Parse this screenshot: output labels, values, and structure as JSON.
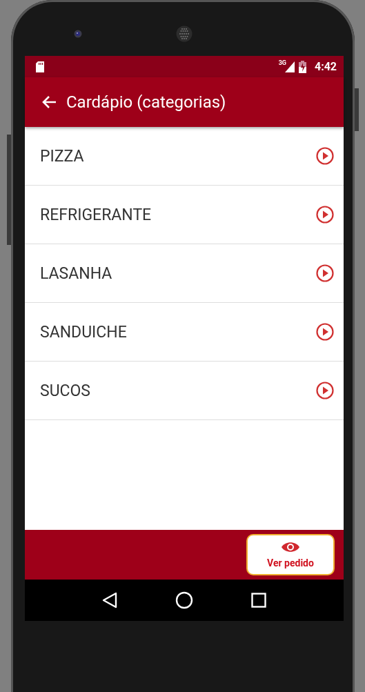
{
  "status_bar": {
    "time": "4:42",
    "network": "3G"
  },
  "app_bar": {
    "title": "Cardápio (categorias)"
  },
  "categories": [
    {
      "label": "PIZZA"
    },
    {
      "label": "REFRIGERANTE"
    },
    {
      "label": "LASANHA"
    },
    {
      "label": "SANDUICHE"
    },
    {
      "label": "SUCOS"
    }
  ],
  "bottom_bar": {
    "button": "Ver pedido"
  }
}
